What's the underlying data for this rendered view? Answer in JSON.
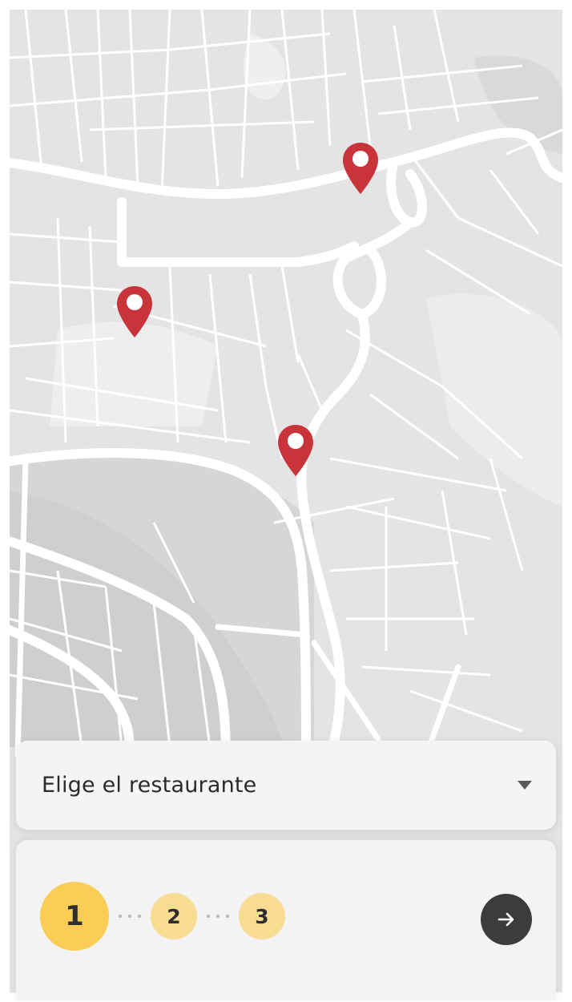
{
  "colors": {
    "map_background": "#e4e4e4",
    "map_roads": "#ffffff",
    "pin": "#c9343a",
    "step_active": "#f9cd56",
    "step_pending": "#f7dc92",
    "next_button": "#3c3c3c"
  },
  "map": {
    "pins": [
      {
        "icon": "map-pin-icon"
      },
      {
        "icon": "map-pin-icon"
      },
      {
        "icon": "map-pin-icon"
      }
    ]
  },
  "restaurant_select": {
    "label": "Elige el restaurante",
    "icon": "caret-down-icon"
  },
  "stepper": {
    "steps": [
      {
        "label": "1",
        "state": "active"
      },
      {
        "label": "2",
        "state": "pending"
      },
      {
        "label": "3",
        "state": "pending"
      }
    ],
    "current_step": 1,
    "total_steps": 3
  },
  "next_button": {
    "icon": "arrow-right-icon"
  }
}
